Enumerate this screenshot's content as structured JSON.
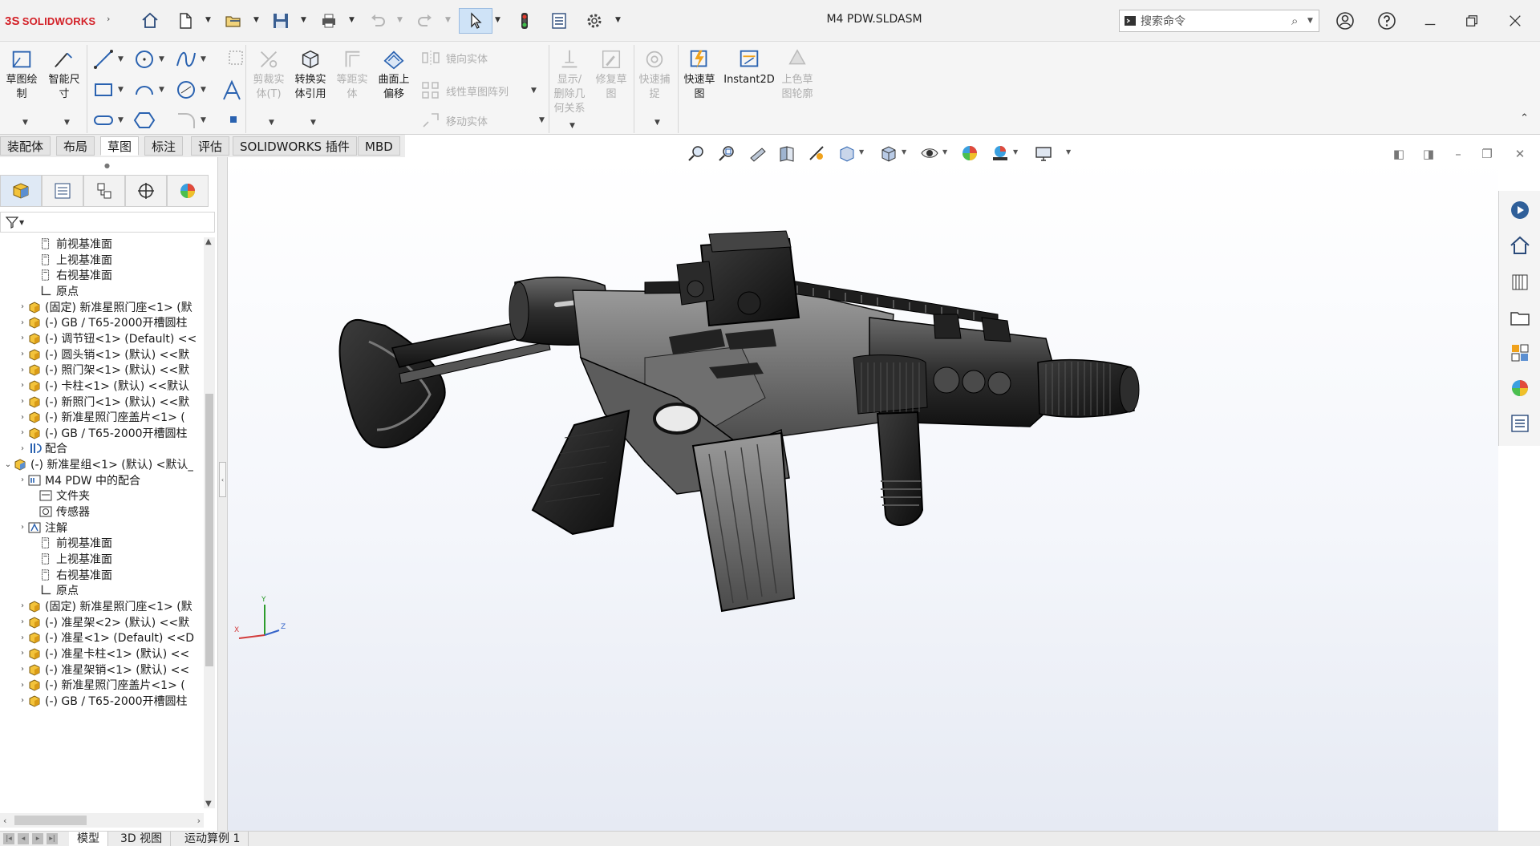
{
  "app": {
    "logo_prefix": "3S",
    "logo_text": "SOLIDWORKS",
    "window_title": "M4 PDW.SLDASM",
    "search_placeholder": "搜索命令"
  },
  "ribbon": {
    "sketch": "草图绘\n制",
    "smart_dim": "智能尺\n寸",
    "trim": "剪裁实\n体(T)",
    "convert": "转换实\n体引用",
    "offset": "等距实\n体",
    "surface_offset": "曲面上\n偏移",
    "mirror": "镜向实体",
    "linear_pattern": "线性草图阵列",
    "move": "移动实体",
    "display_relations": "显示/\n删除几\n何关系",
    "repair": "修复草\n图",
    "rapid_snaps": "快速捕\n捉",
    "rapid_sketch": "快速草\n图",
    "instant2d": "Instant2D",
    "shaded_contours": "上色草\n图轮廓"
  },
  "tabs": [
    {
      "label": "装配体"
    },
    {
      "label": "布局"
    },
    {
      "label": "草图"
    },
    {
      "label": "标注"
    },
    {
      "label": "评估"
    },
    {
      "label": "SOLIDWORKS 插件"
    },
    {
      "label": "MBD"
    }
  ],
  "tree": [
    {
      "label": "前视基准面",
      "icon": "plane"
    },
    {
      "label": "上视基准面",
      "icon": "plane"
    },
    {
      "label": "右视基准面",
      "icon": "plane"
    },
    {
      "label": "原点",
      "icon": "origin"
    },
    {
      "label": "(固定) 新准星照门座<1> (默",
      "icon": "part"
    },
    {
      "label": "(-) GB / T65-2000开槽圆柱",
      "icon": "part"
    },
    {
      "label": "(-) 调节钮<1> (Default) <<",
      "icon": "part"
    },
    {
      "label": "(-) 圆头销<1> (默认) <<默",
      "icon": "part"
    },
    {
      "label": "(-) 照门架<1> (默认) <<默",
      "icon": "part"
    },
    {
      "label": "(-) 卡柱<1> (默认) <<默认",
      "icon": "part"
    },
    {
      "label": "(-) 新照门<1> (默认) <<默",
      "icon": "part"
    },
    {
      "label": "(-) 新准星照门座盖片<1> (",
      "icon": "part"
    },
    {
      "label": "(-) GB / T65-2000开槽圆柱",
      "icon": "part"
    },
    {
      "label": "配合",
      "icon": "mates"
    },
    {
      "label": "(-) 新准星组<1> (默认) <默认_",
      "icon": "asm"
    },
    {
      "label": "M4 PDW 中的配合",
      "icon": "mates2"
    },
    {
      "label": "文件夹",
      "icon": "folder"
    },
    {
      "label": "传感器",
      "icon": "sensor"
    },
    {
      "label": "注解",
      "icon": "annot"
    },
    {
      "label": "前视基准面",
      "icon": "plane"
    },
    {
      "label": "上视基准面",
      "icon": "plane"
    },
    {
      "label": "右视基准面",
      "icon": "plane"
    },
    {
      "label": "原点",
      "icon": "origin"
    },
    {
      "label": "(固定) 新准星照门座<1> (默",
      "icon": "part"
    },
    {
      "label": "(-) 准星架<2> (默认) <<默",
      "icon": "part"
    },
    {
      "label": "(-) 准星<1> (Default) <<D",
      "icon": "part"
    },
    {
      "label": "(-) 准星卡柱<1> (默认) <<",
      "icon": "part"
    },
    {
      "label": "(-) 准星架销<1> (默认) <<",
      "icon": "part"
    },
    {
      "label": "(-) 新准星照门座盖片<1> (",
      "icon": "part"
    },
    {
      "label": "(-) GB / T65-2000开槽圆柱",
      "icon": "part"
    }
  ],
  "bottom_tabs": [
    {
      "label": "模型"
    },
    {
      "label": "3D 视图"
    },
    {
      "label": "运动算例 1"
    }
  ],
  "triad": {
    "x": "X",
    "y": "Y",
    "z": "Z"
  },
  "colors": {
    "accent": "#d32027",
    "selected": "#cfe3f7",
    "viewport_bottom": "#e6eaf3"
  }
}
